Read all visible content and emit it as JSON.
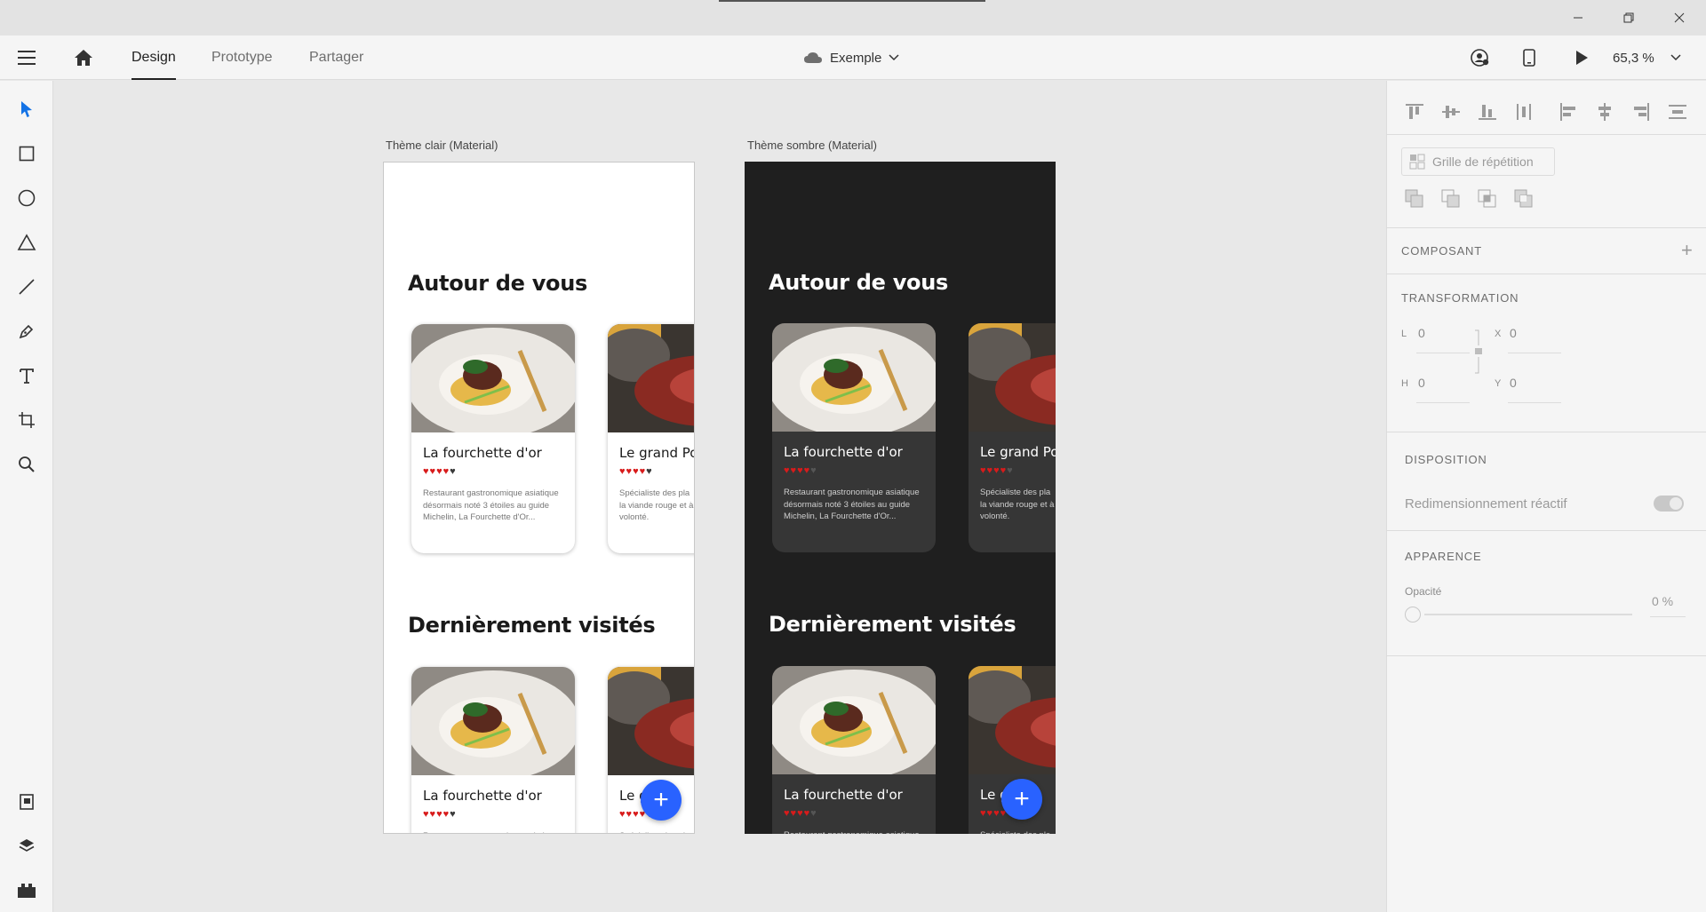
{
  "appbar": {
    "tabs": [
      {
        "label": "Design"
      },
      {
        "label": "Prototype"
      },
      {
        "label": "Partager"
      }
    ],
    "document_name": "Exemple",
    "zoom": "65,3 %"
  },
  "canvas": {
    "light_label": "Thème clair (Material)",
    "dark_label": "Thème sombre (Material)",
    "section_nearby": "Autour de vous",
    "section_recent": "Dernièrement visités",
    "card1": {
      "name": "La fourchette d'or",
      "desc": "Restaurant gastronomique asiatique désormais noté 3 étoiles au guide Michelin, La Fourchette d'Or...",
      "rating": 4
    },
    "card2": {
      "name": "Le grand Po",
      "desc": "Spécialiste des pla la viande rouge et à volonté.",
      "rating": 4
    },
    "card2_recent_name": "Le g      Po"
  },
  "panel": {
    "repeat_grid": "Grille de répétition",
    "component_header": "COMPOSANT",
    "component_add": "+",
    "transform_header": "TRANSFORMATION",
    "w_label": "L",
    "w_value": "0",
    "x_label": "X",
    "x_value": "0",
    "h_label": "H",
    "h_value": "0",
    "y_label": "Y",
    "y_value": "0",
    "layout_header": "DISPOSITION",
    "responsive_resize": "Redimensionnement réactif",
    "appearance_header": "APPARENCE",
    "opacity_label": "Opacité",
    "opacity_value": "0 %"
  },
  "colors": {
    "accent": "#2962ff",
    "star": "#d81b1b",
    "select_tool": "#1473e6"
  }
}
